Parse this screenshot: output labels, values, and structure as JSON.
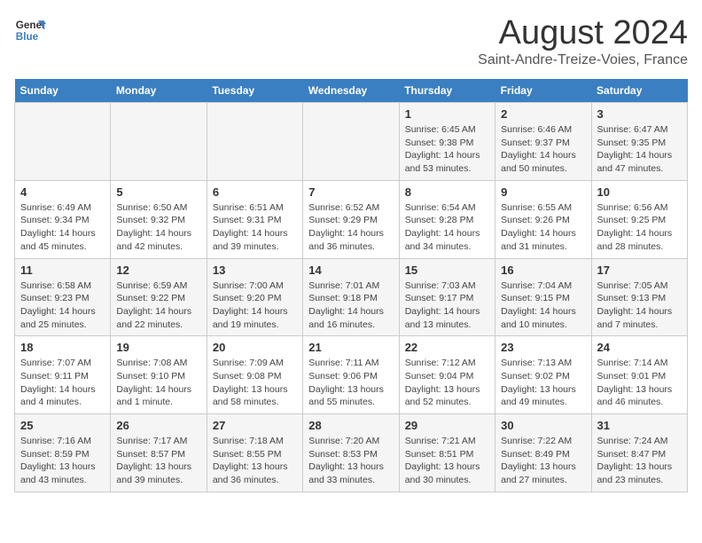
{
  "header": {
    "logo_line1": "General",
    "logo_line2": "Blue",
    "main_title": "August 2024",
    "subtitle": "Saint-Andre-Treize-Voies, France"
  },
  "weekdays": [
    "Sunday",
    "Monday",
    "Tuesday",
    "Wednesday",
    "Thursday",
    "Friday",
    "Saturday"
  ],
  "weeks": [
    [
      {
        "day": "",
        "info": ""
      },
      {
        "day": "",
        "info": ""
      },
      {
        "day": "",
        "info": ""
      },
      {
        "day": "",
        "info": ""
      },
      {
        "day": "1",
        "info": "Sunrise: 6:45 AM\nSunset: 9:38 PM\nDaylight: 14 hours\nand 53 minutes."
      },
      {
        "day": "2",
        "info": "Sunrise: 6:46 AM\nSunset: 9:37 PM\nDaylight: 14 hours\nand 50 minutes."
      },
      {
        "day": "3",
        "info": "Sunrise: 6:47 AM\nSunset: 9:35 PM\nDaylight: 14 hours\nand 47 minutes."
      }
    ],
    [
      {
        "day": "4",
        "info": "Sunrise: 6:49 AM\nSunset: 9:34 PM\nDaylight: 14 hours\nand 45 minutes."
      },
      {
        "day": "5",
        "info": "Sunrise: 6:50 AM\nSunset: 9:32 PM\nDaylight: 14 hours\nand 42 minutes."
      },
      {
        "day": "6",
        "info": "Sunrise: 6:51 AM\nSunset: 9:31 PM\nDaylight: 14 hours\nand 39 minutes."
      },
      {
        "day": "7",
        "info": "Sunrise: 6:52 AM\nSunset: 9:29 PM\nDaylight: 14 hours\nand 36 minutes."
      },
      {
        "day": "8",
        "info": "Sunrise: 6:54 AM\nSunset: 9:28 PM\nDaylight: 14 hours\nand 34 minutes."
      },
      {
        "day": "9",
        "info": "Sunrise: 6:55 AM\nSunset: 9:26 PM\nDaylight: 14 hours\nand 31 minutes."
      },
      {
        "day": "10",
        "info": "Sunrise: 6:56 AM\nSunset: 9:25 PM\nDaylight: 14 hours\nand 28 minutes."
      }
    ],
    [
      {
        "day": "11",
        "info": "Sunrise: 6:58 AM\nSunset: 9:23 PM\nDaylight: 14 hours\nand 25 minutes."
      },
      {
        "day": "12",
        "info": "Sunrise: 6:59 AM\nSunset: 9:22 PM\nDaylight: 14 hours\nand 22 minutes."
      },
      {
        "day": "13",
        "info": "Sunrise: 7:00 AM\nSunset: 9:20 PM\nDaylight: 14 hours\nand 19 minutes."
      },
      {
        "day": "14",
        "info": "Sunrise: 7:01 AM\nSunset: 9:18 PM\nDaylight: 14 hours\nand 16 minutes."
      },
      {
        "day": "15",
        "info": "Sunrise: 7:03 AM\nSunset: 9:17 PM\nDaylight: 14 hours\nand 13 minutes."
      },
      {
        "day": "16",
        "info": "Sunrise: 7:04 AM\nSunset: 9:15 PM\nDaylight: 14 hours\nand 10 minutes."
      },
      {
        "day": "17",
        "info": "Sunrise: 7:05 AM\nSunset: 9:13 PM\nDaylight: 14 hours\nand 7 minutes."
      }
    ],
    [
      {
        "day": "18",
        "info": "Sunrise: 7:07 AM\nSunset: 9:11 PM\nDaylight: 14 hours\nand 4 minutes."
      },
      {
        "day": "19",
        "info": "Sunrise: 7:08 AM\nSunset: 9:10 PM\nDaylight: 14 hours\nand 1 minute."
      },
      {
        "day": "20",
        "info": "Sunrise: 7:09 AM\nSunset: 9:08 PM\nDaylight: 13 hours\nand 58 minutes."
      },
      {
        "day": "21",
        "info": "Sunrise: 7:11 AM\nSunset: 9:06 PM\nDaylight: 13 hours\nand 55 minutes."
      },
      {
        "day": "22",
        "info": "Sunrise: 7:12 AM\nSunset: 9:04 PM\nDaylight: 13 hours\nand 52 minutes."
      },
      {
        "day": "23",
        "info": "Sunrise: 7:13 AM\nSunset: 9:02 PM\nDaylight: 13 hours\nand 49 minutes."
      },
      {
        "day": "24",
        "info": "Sunrise: 7:14 AM\nSunset: 9:01 PM\nDaylight: 13 hours\nand 46 minutes."
      }
    ],
    [
      {
        "day": "25",
        "info": "Sunrise: 7:16 AM\nSunset: 8:59 PM\nDaylight: 13 hours\nand 43 minutes."
      },
      {
        "day": "26",
        "info": "Sunrise: 7:17 AM\nSunset: 8:57 PM\nDaylight: 13 hours\nand 39 minutes."
      },
      {
        "day": "27",
        "info": "Sunrise: 7:18 AM\nSunset: 8:55 PM\nDaylight: 13 hours\nand 36 minutes."
      },
      {
        "day": "28",
        "info": "Sunrise: 7:20 AM\nSunset: 8:53 PM\nDaylight: 13 hours\nand 33 minutes."
      },
      {
        "day": "29",
        "info": "Sunrise: 7:21 AM\nSunset: 8:51 PM\nDaylight: 13 hours\nand 30 minutes."
      },
      {
        "day": "30",
        "info": "Sunrise: 7:22 AM\nSunset: 8:49 PM\nDaylight: 13 hours\nand 27 minutes."
      },
      {
        "day": "31",
        "info": "Sunrise: 7:24 AM\nSunset: 8:47 PM\nDaylight: 13 hours\nand 23 minutes."
      }
    ]
  ]
}
